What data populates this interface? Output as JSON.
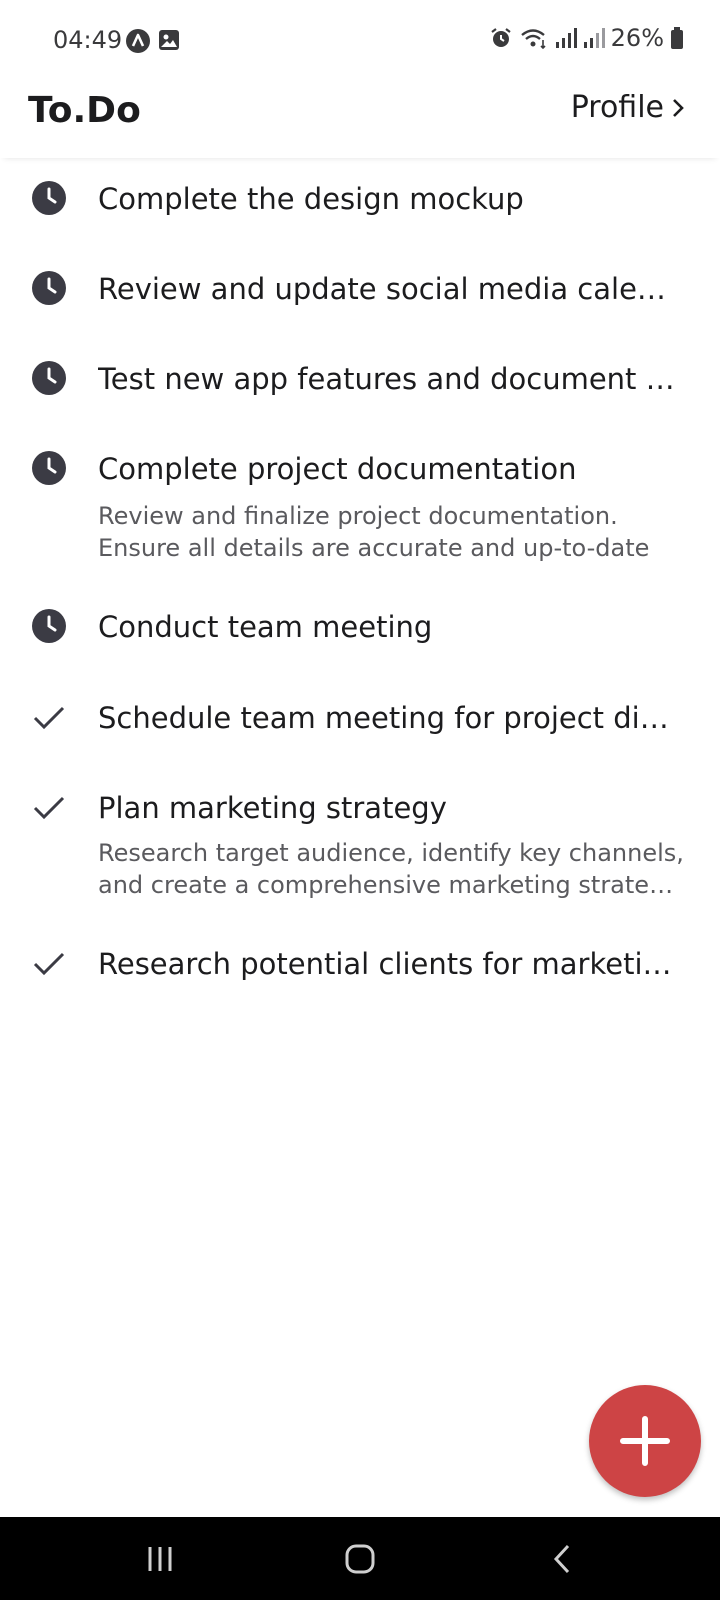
{
  "status_bar": {
    "time": "04:49",
    "battery": "26%",
    "icons": [
      "app-notification-icon",
      "gallery-icon",
      "alarm-icon",
      "wifi-icon",
      "signal-icon",
      "signal-icon-2",
      "battery-icon"
    ]
  },
  "header": {
    "title": "To.Do",
    "profile_label": "Profile"
  },
  "tasks": [
    {
      "title": "Complete the design mockup",
      "description": [],
      "status": "pending",
      "icon": "clock-icon"
    },
    {
      "title": "Review and update social media calendar",
      "description": [],
      "status": "pending",
      "icon": "clock-icon"
    },
    {
      "title": "Test new app features and document bu…",
      "description": [],
      "status": "pending",
      "icon": "clock-icon"
    },
    {
      "title": "Complete project documentation",
      "description": [
        "Review and finalize project documentation.",
        "Ensure all details are accurate and up-to-date"
      ],
      "status": "pending",
      "icon": "clock-icon"
    },
    {
      "title": "Conduct team meeting",
      "description": [],
      "status": "pending",
      "icon": "clock-icon"
    },
    {
      "title": "Schedule team meeting for project disc…",
      "description": [],
      "status": "done",
      "icon": "check-icon"
    },
    {
      "title": "Plan marketing strategy",
      "description": [
        "Research target audience, identify key channels,",
        "and create a comprehensive marketing strate…"
      ],
      "status": "done",
      "icon": "check-icon"
    },
    {
      "title": "Research potential clients for marketing",
      "description": [],
      "status": "done",
      "icon": "check-icon"
    }
  ],
  "fab": {
    "icon": "plus-icon",
    "color": "#cd4445"
  },
  "nav": {
    "buttons": [
      "recent-apps-icon",
      "home-icon",
      "back-icon"
    ]
  }
}
